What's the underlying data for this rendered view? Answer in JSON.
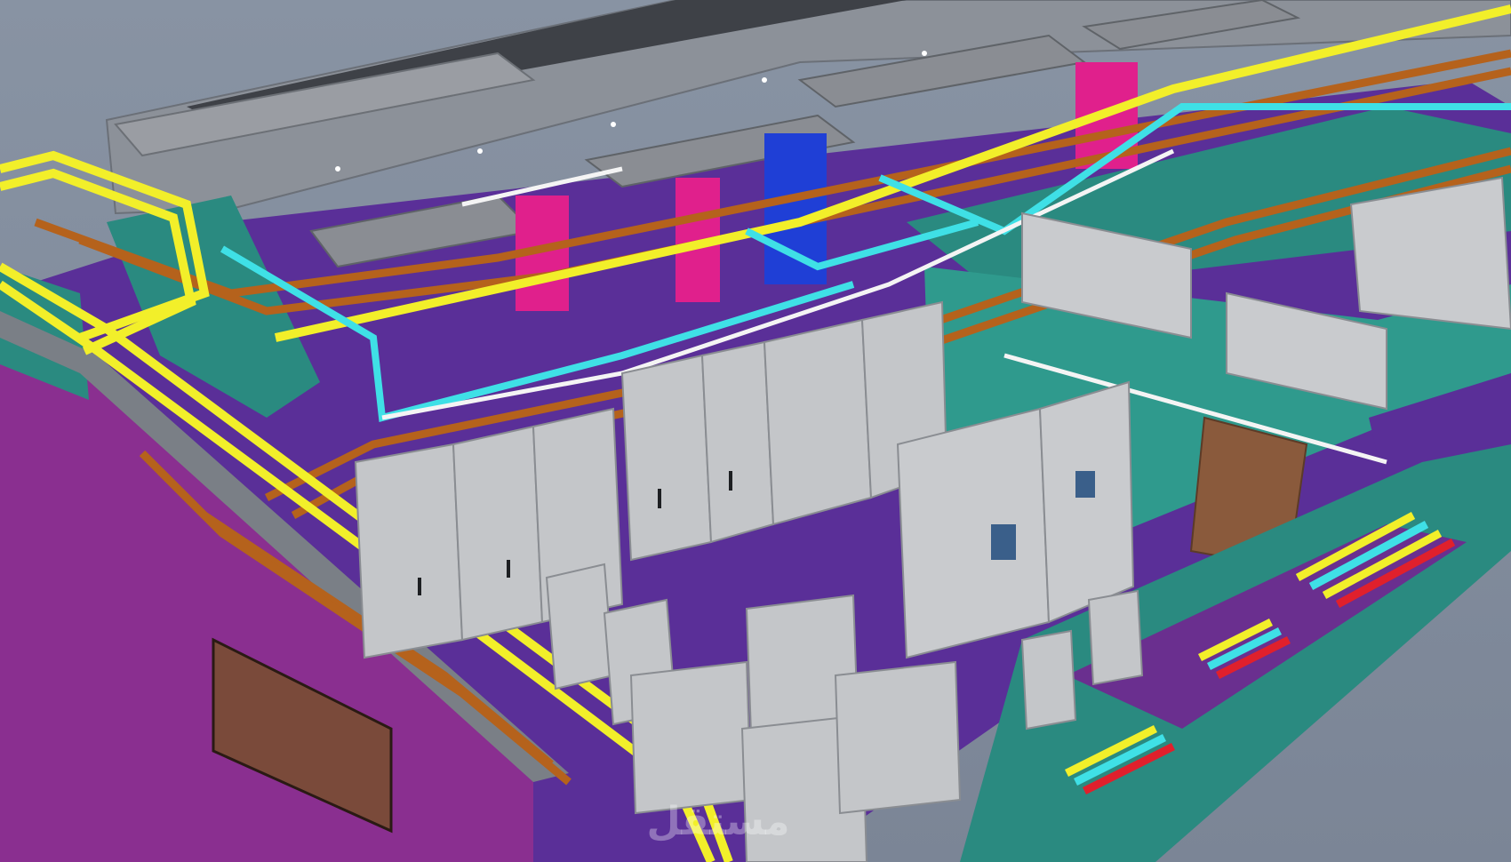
{
  "scene": {
    "subject": "electrical-room-bim-model",
    "colors": {
      "background": "#7f8a9a",
      "floor": "#5a2f98",
      "wall_teal": "#2a8a80",
      "wall_magenta": "#a6389c",
      "ceiling_slab": "#8f949b",
      "duct_gray": "#8a8d93",
      "cabinet": "#c4c6c9",
      "cable_tray_orange": "#b5621c",
      "conduit_yellow": "#f2ef2a",
      "conduit_cyan": "#3fe0e6",
      "conduit_white": "#f4f4f4",
      "pipe_magenta": "#e0208c",
      "duct_blue": "#1f3fd6",
      "door_brown": "#8a5a3c"
    }
  },
  "watermark": {
    "text": "مستقل",
    "icon": "watermark-logo"
  }
}
